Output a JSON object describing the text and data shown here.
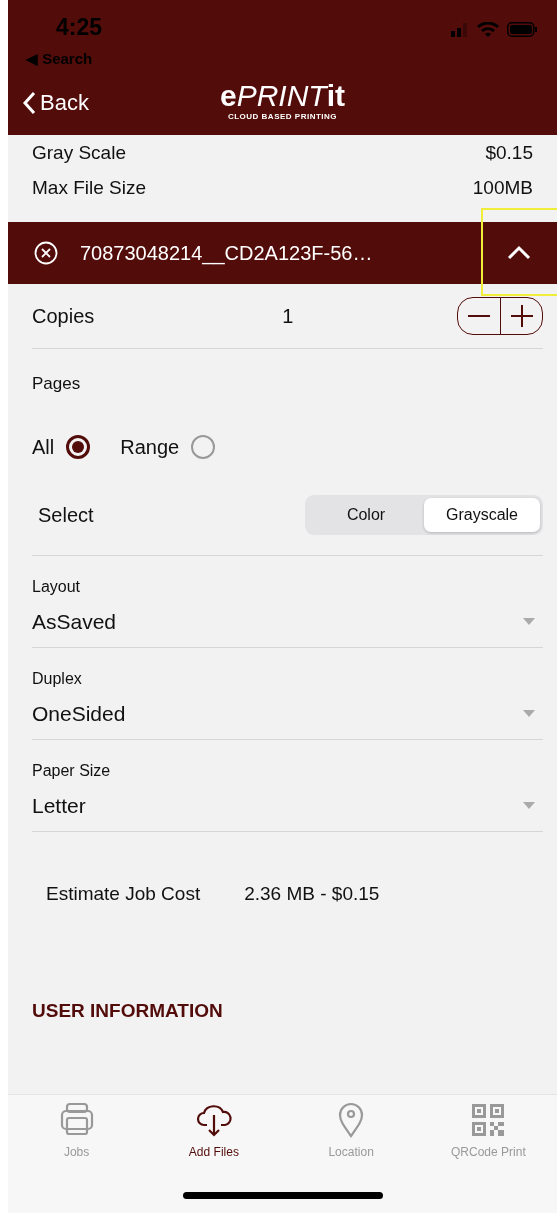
{
  "status_bar": {
    "time": "4:25",
    "back_app": "◀ Search"
  },
  "nav": {
    "back": "Back",
    "logo": [
      "e",
      "PRINT",
      "it"
    ],
    "tagline": "CLOUD BASED PRINTING"
  },
  "pricing": [
    {
      "label": "Gray Scale",
      "value": "$0.15"
    },
    {
      "label": "Max File Size",
      "value": "100MB"
    }
  ],
  "file": {
    "name": "70873048214__CD2A123F-56…",
    "expanded": true,
    "highlighted": true
  },
  "copies": {
    "label": "Copies",
    "value": "1"
  },
  "pages": {
    "label": "Pages",
    "options": [
      {
        "label": "All",
        "selected": true
      },
      {
        "label": "Range",
        "selected": false
      }
    ]
  },
  "color_mode": {
    "label": "Select",
    "options": [
      {
        "label": "Color",
        "selected": false
      },
      {
        "label": "Grayscale",
        "selected": true
      }
    ]
  },
  "dropdowns": [
    {
      "label": "Layout",
      "value": "AsSaved"
    },
    {
      "label": "Duplex",
      "value": "OneSided"
    },
    {
      "label": "Paper Size",
      "value": "Letter"
    }
  ],
  "estimate": {
    "label": "Estimate Job Cost",
    "value": "2.36 MB - $0.15"
  },
  "section_title": "USER INFORMATION",
  "tabs": [
    {
      "kind": "printer",
      "label": "Jobs",
      "selected": false
    },
    {
      "kind": "cloud",
      "label": "Add Files",
      "selected": true
    },
    {
      "kind": "pin",
      "label": "Location",
      "selected": false
    },
    {
      "kind": "qr",
      "label": "QRCode Print",
      "selected": false
    }
  ]
}
